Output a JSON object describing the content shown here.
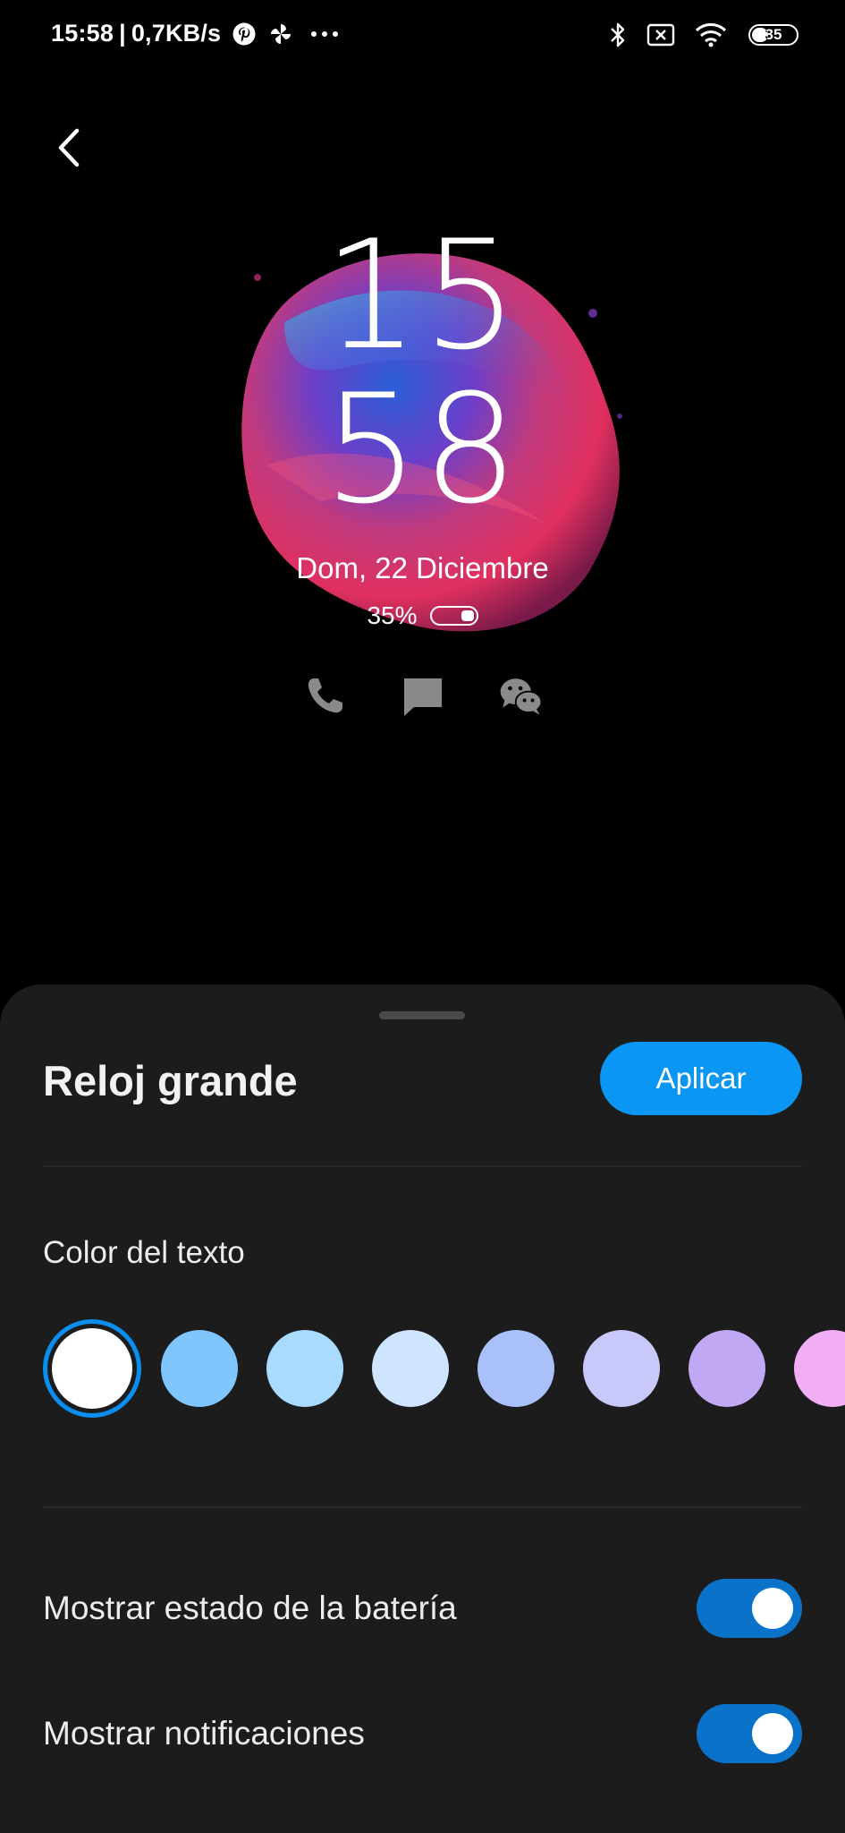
{
  "status_bar": {
    "time": "15:58",
    "separator": "|",
    "net_speed": "0,7KB/s",
    "left_icons": [
      "pinterest-icon",
      "pinwheel-icon",
      "more-dots-icon"
    ],
    "right_icons": [
      "bluetooth-icon",
      "no-sim-icon",
      "wifi-icon"
    ],
    "battery_level": "35"
  },
  "preview": {
    "clock_hours": "15",
    "clock_minutes": "58",
    "date": "Dom, 22 Diciembre",
    "battery_percent": "35%",
    "shortcut_icons": [
      "phone-icon",
      "message-icon",
      "wechat-icon"
    ]
  },
  "sheet": {
    "title": "Reloj grande",
    "apply_label": "Aplicar",
    "color_section_label": "Color del texto",
    "swatch_colors": [
      "#ffffff",
      "#7fc6ff",
      "#a8dbff",
      "#cfe4ff",
      "#a9c0fa",
      "#c9c8fb",
      "#c1a8f5",
      "#f2aef5"
    ],
    "selected_swatch_index": 0,
    "settings": [
      {
        "label": "Mostrar estado de la batería",
        "enabled": true
      },
      {
        "label": "Mostrar notificaciones",
        "enabled": true
      }
    ]
  },
  "colors": {
    "accent": "#0a96f5",
    "toggle_on": "#0a72c9",
    "sheet_background": "#1c1c1c"
  }
}
